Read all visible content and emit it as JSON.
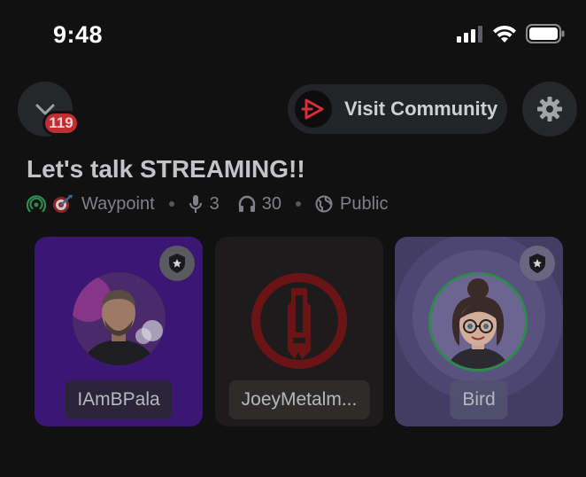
{
  "status_bar": {
    "time": "9:48"
  },
  "header": {
    "notification_count": "119",
    "visit_label": "Visit Community"
  },
  "stage": {
    "title": "Let's talk STREAMING!!",
    "category": "Waypoint",
    "speakers": "3",
    "listeners": "30",
    "visibility": "Public"
  },
  "participants": [
    {
      "name": "IAmBPala",
      "moderator": true
    },
    {
      "name": "JoeyMetalm...",
      "moderator": false
    },
    {
      "name": "Bird",
      "moderator": true
    }
  ],
  "colors": {
    "background": "#111112",
    "badge": "#bf2f32",
    "tile_1": "#3c1673",
    "tile_2": "#1e1b1c",
    "tile_3": "#433c63",
    "live_green": "#2f8a4d",
    "brand_red": "#d62f35"
  },
  "icons": {
    "collapse": "chevron-down-icon",
    "settings": "gear-icon",
    "stage_live": "stage-icon",
    "mic": "microphone-icon",
    "listeners": "headphones-icon",
    "visibility": "globe-icon",
    "moderator": "shield-star-icon"
  }
}
